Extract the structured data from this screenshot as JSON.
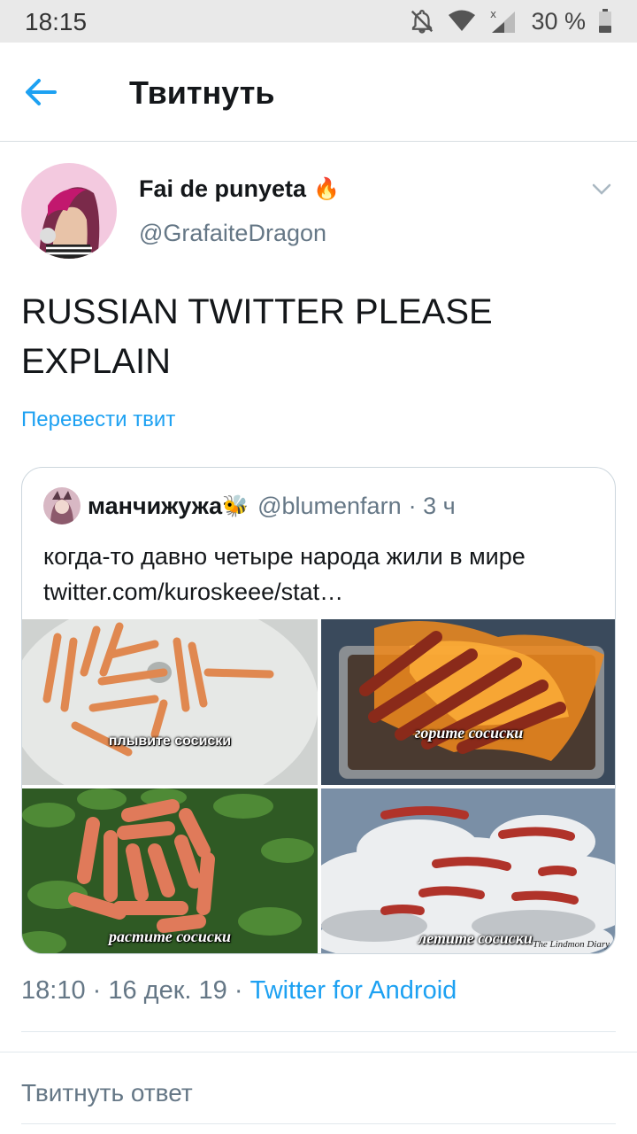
{
  "status_bar": {
    "time": "18:15",
    "battery": "30 %",
    "icons": [
      "bell-off-icon",
      "wifi-icon",
      "signal-icon",
      "battery-icon"
    ]
  },
  "header": {
    "title": "Твитнуть",
    "back_icon": "arrow-left-icon"
  },
  "tweet": {
    "author_name": "Fai de punyeta",
    "author_emoji": "🔥",
    "author_handle": "@GrafaiteDragon",
    "text": "RUSSIAN TWITTER PLEASE EXPLAIN",
    "translate_label": "Перевести твит",
    "time": "18:10",
    "date": "16 дек. 19",
    "separator": " · ",
    "source": "Twitter for Android"
  },
  "quote": {
    "name": "манчижужа",
    "name_emoji": "🐝",
    "handle": "@blumenfarn",
    "time": "· 3 ч",
    "text": "когда-то давно четыре народа жили в мире twitter.com/kuroskeee/stat…",
    "images": [
      {
        "caption": "плывите сосиски"
      },
      {
        "caption": "горите сосиски"
      },
      {
        "caption": "растите сосиски"
      },
      {
        "caption": "летите сосиски",
        "watermark": "The Lindmon Diary"
      }
    ]
  },
  "reply": {
    "placeholder": "Твитнуть ответ"
  },
  "colors": {
    "accent": "#1da1f2",
    "secondary_text": "#657786",
    "border": "#ccd6dd"
  }
}
